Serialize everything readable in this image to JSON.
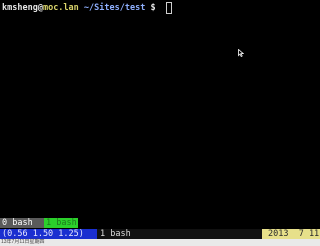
{
  "terminal": {
    "prompt": {
      "user": "kmsheng",
      "at": "@",
      "host": "moc.lan",
      "path": "~/Sites/test",
      "symbol": "$"
    }
  },
  "tmux": {
    "tabs": [
      {
        "label": "0 bash"
      },
      {
        "label": "1 bash"
      }
    ],
    "status": {
      "load": "(0.56 1.50 1.25)",
      "window": "1 bash",
      "date": "2013  7 11"
    }
  },
  "footer": {
    "label": "13年7月11日星期四"
  },
  "colors": {
    "background": "#000000",
    "host": "#d9d36a",
    "path": "#8fb0ff",
    "active_tab": "#2bd02b",
    "load_bg": "#1a2fd0",
    "date_bg": "#e7e08a"
  }
}
